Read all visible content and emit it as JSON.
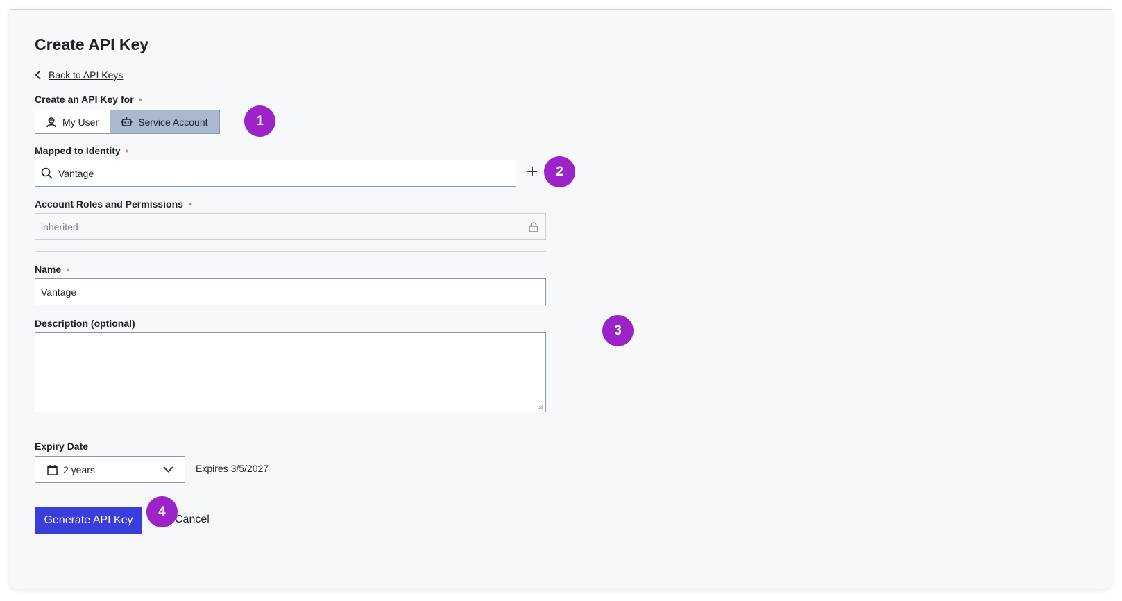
{
  "page": {
    "title": "Create API Key",
    "back_link": "Back to API Keys"
  },
  "key_for": {
    "label": "Create an API Key for",
    "options": [
      {
        "label": "My User",
        "icon": "user-icon",
        "selected": false
      },
      {
        "label": "Service Account",
        "icon": "robot-icon",
        "selected": true
      }
    ]
  },
  "identity": {
    "label": "Mapped to Identity",
    "value": "Vantage",
    "icon": "search-icon",
    "add_icon": "plus-icon"
  },
  "roles": {
    "label": "Account Roles and Permissions",
    "value": "inherited",
    "icon": "lock-icon"
  },
  "name": {
    "label": "Name",
    "value": "Vantage"
  },
  "description": {
    "label": "Description (optional)",
    "value": ""
  },
  "expiry": {
    "label": "Expiry Date",
    "selected": "2 years",
    "note": "Expires 3/5/2027",
    "icon": "calendar-icon"
  },
  "actions": {
    "generate": "Generate API Key",
    "cancel": "Cancel"
  },
  "badges": [
    "1",
    "2",
    "3",
    "4"
  ],
  "colors": {
    "primary": "#3a3fdc",
    "badge": "#9b23c8",
    "required": "#f08a4b",
    "segment_active": "#a9b9cf"
  }
}
